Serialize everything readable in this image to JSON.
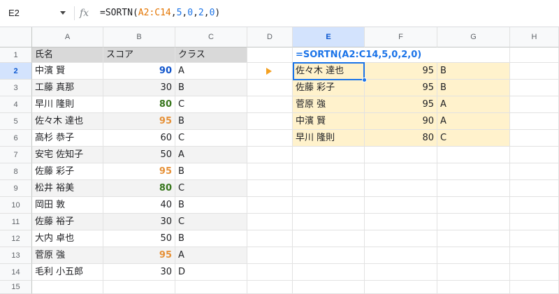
{
  "namebox": "E2",
  "formula": {
    "fx_label": "fx",
    "prefix": "=SORTN(",
    "range": "A2:C14",
    "sep1": ",",
    "n1": "5",
    "sep2": ",",
    "n2": "0",
    "sep3": ",",
    "n3": "2",
    "sep4": ",",
    "n4": "0",
    "suffix": ")"
  },
  "columns": [
    "A",
    "B",
    "C",
    "D",
    "E",
    "F",
    "G",
    "H"
  ],
  "rows": [
    "1",
    "2",
    "3",
    "4",
    "5",
    "6",
    "7",
    "8",
    "9",
    "10",
    "11",
    "12",
    "13",
    "14",
    "15"
  ],
  "headers": [
    "氏名",
    "スコア",
    "クラス"
  ],
  "data": [
    [
      "中濱 賢",
      "90",
      "A"
    ],
    [
      "工藤 真那",
      "30",
      "B"
    ],
    [
      "早川 隆則",
      "80",
      "C"
    ],
    [
      "佐々木 達也",
      "95",
      "B"
    ],
    [
      "高杉 恭子",
      "60",
      "C"
    ],
    [
      "安宅 佐知子",
      "50",
      "A"
    ],
    [
      "佐藤 彩子",
      "95",
      "B"
    ],
    [
      "松井 裕美",
      "80",
      "C"
    ],
    [
      "岡田 敦",
      "40",
      "B"
    ],
    [
      "佐藤 裕子",
      "30",
      "C"
    ],
    [
      "大内 卓也",
      "50",
      "B"
    ],
    [
      "菅原 強",
      "95",
      "A"
    ],
    [
      "毛利 小五郎",
      "30",
      "D"
    ]
  ],
  "result_formula": "=SORTN(A2:C14,5,0,2,0)",
  "results": [
    [
      "佐々木 達也",
      "95",
      "B"
    ],
    [
      "佐藤 彩子",
      "95",
      "B"
    ],
    [
      "菅原 強",
      "95",
      "A"
    ],
    [
      "中濱 賢",
      "90",
      "A"
    ],
    [
      "早川 隆則",
      "80",
      "C"
    ]
  ],
  "colors": {
    "score_95": "#e69138",
    "score_90": "#1155cc",
    "score_80": "#38761d",
    "result_fill": "#fff2cc",
    "header_fill": "#d9d9d9",
    "selection": "#1a73e8",
    "arrow": "#f4a020"
  }
}
